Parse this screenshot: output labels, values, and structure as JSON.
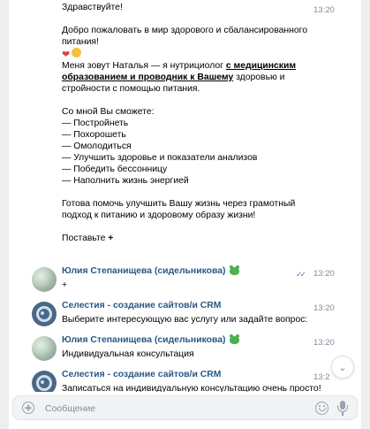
{
  "first_message": {
    "time": "13:20",
    "greeting": "Здравствуйте!",
    "welcome": "Добро пожаловать в мир здорового и сбалансированного питания!",
    "intro_before": "Меня зовут Наталья — я нутрициолог ",
    "intro_bold": "с медицинским образованием и проводник к Вашему",
    "intro_after": " здоровью и стройности с помощью питания.",
    "list_title": "Со мной Вы сможете:",
    "list": [
      "— Постройнеть",
      "— Похорошеть",
      "— Омолодиться",
      "— Улучшить здоровье и показатели анализов",
      "— Победить бессонницу",
      "— Наполнить жизнь энергией"
    ],
    "offer": "Готова помочь улучшить Вашу жизнь через грамотный подход к питанию и здоровому образу жизни!",
    "cta": "Поставьте ",
    "cta_plus": "+"
  },
  "messages": [
    {
      "author": "Юлия Степанищева (сидельникова)",
      "text": "+",
      "time": "13:20",
      "read": "✓✓"
    },
    {
      "author": "Селестия - создание сайтов/и CRM",
      "text": "Выберите интересующую вас услугу или задайте вопрос:",
      "time": "13:20",
      "read": ""
    },
    {
      "author": "Юлия Степанищева (сидельникова)",
      "text": "Индивидуальная консультация",
      "time": "13:20",
      "read": ""
    },
    {
      "author": "Селестия - создание сайтов/и CRM",
      "text": "Записаться на индивидуальную консультацию очень просто!",
      "time": "13:2",
      "read": ""
    }
  ],
  "composer": {
    "placeholder": "Сообщение"
  },
  "icons": {
    "attach": "plus-circle-icon",
    "emoji": "smile-icon",
    "mic": "microphone-icon",
    "scroll": "chevron-down-icon",
    "badge": "frog-icon"
  },
  "colors": {
    "author": "#2a5885",
    "time": "#818c99",
    "read": "#5181b8",
    "background_side": "#edeef0"
  }
}
